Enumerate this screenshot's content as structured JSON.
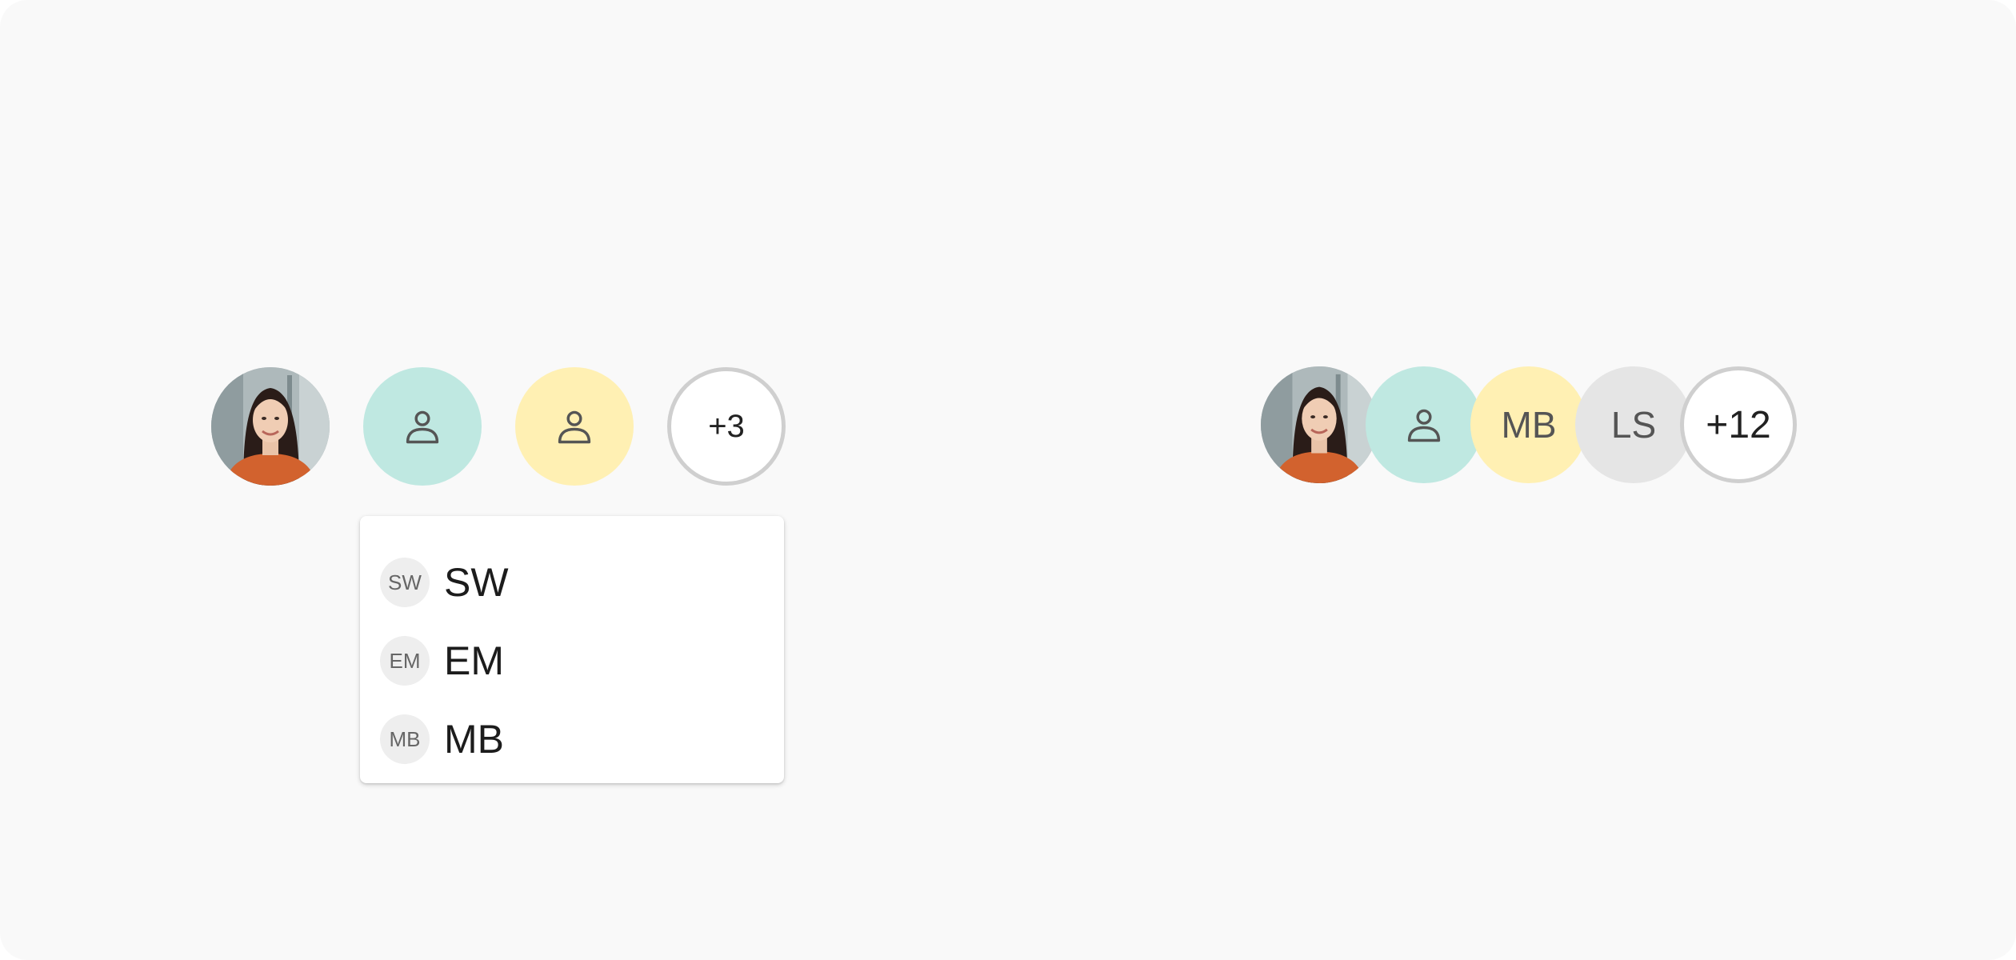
{
  "colors": {
    "teal": "#bfe8e1",
    "yellow": "#fff0b3",
    "gray": "#e5e5e5",
    "overflow_border": "#cfcfcf"
  },
  "group_left": {
    "avatars": [
      {
        "kind": "photo",
        "icon": "user-photo"
      },
      {
        "kind": "icon",
        "icon": "person-icon",
        "color": "#bfe8e1"
      },
      {
        "kind": "icon",
        "icon": "person-icon",
        "color": "#fff0b3"
      }
    ],
    "overflow_label": "+3"
  },
  "dropdown": {
    "items": [
      {
        "initials": "SW",
        "label": "SW"
      },
      {
        "initials": "EM",
        "label": "EM"
      },
      {
        "initials": "MB",
        "label": "MB"
      }
    ]
  },
  "group_right": {
    "avatars": [
      {
        "kind": "photo",
        "icon": "user-photo"
      },
      {
        "kind": "icon",
        "icon": "person-icon",
        "color": "#bfe8e1"
      },
      {
        "kind": "initials",
        "label": "MB",
        "color": "#fff0b3"
      },
      {
        "kind": "initials",
        "label": "LS",
        "color": "#e5e5e5"
      }
    ],
    "overflow_label": "+12"
  }
}
